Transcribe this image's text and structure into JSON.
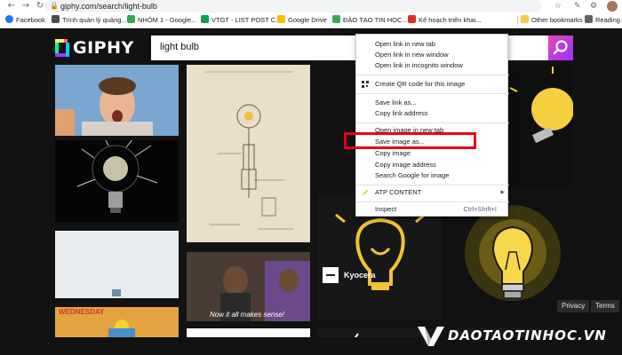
{
  "browser": {
    "url": "giphy.com/search/light-bulb",
    "bookmarks": [
      {
        "label": "Facebook",
        "color": "#1877f2"
      },
      {
        "label": "Trình quản lý quảng...",
        "color": "#4d4d4d"
      },
      {
        "label": "NHÓM 1 - Google...",
        "color": "#34a853"
      },
      {
        "label": "VTGT - LIST POST C...",
        "color": "#0f9d58"
      },
      {
        "label": "Google Drive",
        "color": "#fbbc04"
      },
      {
        "label": "ĐÀO TẠO TIN HỌC...",
        "color": "#34a853"
      },
      {
        "label": "Kế hoạch triển khai...",
        "color": "#d93025"
      }
    ],
    "other_bookmarks": "Other bookmarks",
    "reading": "Reading"
  },
  "giphy": {
    "logo_text": "GIPHY",
    "search_value": "light bulb",
    "tile_caption": "Now it all makes sense!",
    "tile_banner": "WEDNESDAY",
    "channel_label": "Kyocera",
    "privacy": "Privacy",
    "terms": "Terms"
  },
  "context_menu": {
    "items": [
      {
        "label": "Open link in new tab"
      },
      {
        "label": "Open link in new window"
      },
      {
        "label": "Open link in incognito window"
      },
      {
        "label": "Create QR code for this image"
      },
      {
        "label": "Save link as..."
      },
      {
        "label": "Copy link address"
      },
      {
        "label": "Open image in new tab"
      },
      {
        "label": "Save image as..."
      },
      {
        "label": "Copy image"
      },
      {
        "label": "Copy image address"
      },
      {
        "label": "Search Google for image"
      },
      {
        "label": "ATP CONTENT"
      },
      {
        "label": "Inspect",
        "shortcut": "Ctrl+Shift+I"
      }
    ]
  },
  "watermark": {
    "text": "DAOTAOTINHOC.VN"
  },
  "colors": {
    "giphy_bg": "#121212",
    "highlight": "#e8001c",
    "search_btn": "#e646b6"
  }
}
